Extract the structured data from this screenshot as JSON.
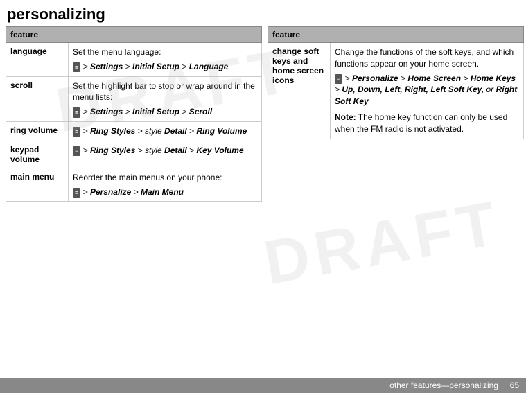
{
  "page": {
    "title": "personalizing",
    "footer": "other features—personalizing",
    "footer_page": "65"
  },
  "left_table": {
    "header": "feature",
    "rows": [
      {
        "name": "language",
        "desc": "Set the menu language:",
        "path": "> Settings > Initial Setup > Language"
      },
      {
        "name": "scroll",
        "desc": "Set the highlight bar to stop or wrap around in the menu lists:",
        "path": "> Settings > Initial Setup > Scroll"
      },
      {
        "name": "ring volume",
        "desc": "",
        "path": "> Ring Styles > style Detail > Ring Volume"
      },
      {
        "name": "keypad volume",
        "desc": "",
        "path": "> Ring Styles > style Detail > Key Volume"
      },
      {
        "name": "main menu",
        "desc": "Reorder the main menus on your phone:",
        "path": "> Persnalize > Main Menu"
      }
    ]
  },
  "right_table": {
    "header": "feature",
    "rows": [
      {
        "name": "change soft keys and home screen icons",
        "desc_1": "Change the functions of the soft keys, and which functions appear on your home screen.",
        "path": "> Personalize > Home Screen > Home Keys > Up, Down, Left, Right, Left Soft Key, or Right Soft Key",
        "note_label": "Note:",
        "note_text": "The home key function can only be used when the FM radio is not activated."
      }
    ]
  }
}
